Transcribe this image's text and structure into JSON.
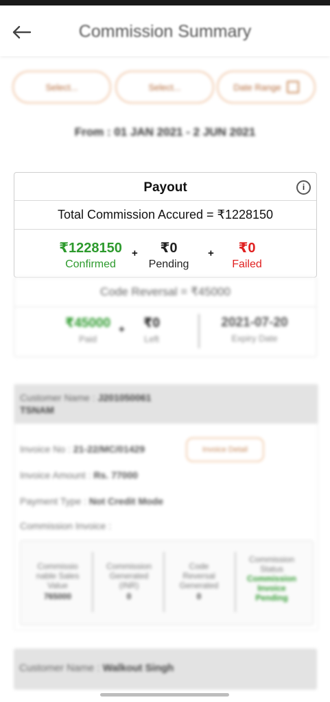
{
  "appbar": {
    "title": "Commission Summary"
  },
  "filters": {
    "pill1": "Select...",
    "pill2": "Select...",
    "date_range_label": "Date Range"
  },
  "date_range_text": "From : 01 JAN 2021 - 2 JUN 2021",
  "payout": {
    "title": "Payout",
    "info_symbol": "i",
    "total_label": "Total Commission Accured = ₹1228150",
    "confirmed": {
      "value": "₹1228150",
      "label": "Confirmed"
    },
    "pending": {
      "value": "₹0",
      "label": "Pending"
    },
    "failed": {
      "value": "₹0",
      "label": "Failed"
    },
    "plus1": "+",
    "plus2": "+"
  },
  "code_reversal": {
    "header": "Code Reversal = ₹45000",
    "paid": {
      "value": "₹45000",
      "label": "Paid"
    },
    "plus": "+",
    "left": {
      "value": "₹0",
      "label": "Left"
    },
    "expiry": {
      "value": "2021-07-20",
      "label": "Expiry Date"
    }
  },
  "invoice_card": {
    "customer_label": "Customer Name :",
    "customer_value_line1": "J201050061",
    "customer_value_line2": "TSNAM",
    "invoice_no_label": "Invoice No :",
    "invoice_no_value": "21-22/MC/01429",
    "invoice_detail_button": "Invoice Detail",
    "invoice_amount_label": "Invoice Amount :",
    "invoice_amount_value": "Rs. 77000",
    "payment_type_label": "Payment Type :",
    "payment_type_value": "Not Credit Mode",
    "commission_invoice_label": "Commission Invoice :",
    "grid": [
      {
        "l1": "Commissio",
        "l2": "nable Sales",
        "l3": "Value",
        "v": "765000"
      },
      {
        "l1": "Commission",
        "l2": "Generated",
        "l3": "(INR)",
        "v": "0"
      },
      {
        "l1": "Code",
        "l2": "Reversal",
        "l3": "Generated",
        "v": "0"
      },
      {
        "l1": "Commission",
        "l2": "Status",
        "g1": "Commission",
        "g2": "Invoice",
        "g3": "Pending"
      }
    ]
  },
  "second_card": {
    "customer_label": "Customer Name :",
    "customer_value": "Walkout Singh"
  },
  "colors": {
    "accent": "#f0c7a8",
    "green": "#2d9a2d",
    "red": "#e02020"
  },
  "icons": {
    "back": "arrow-left-icon",
    "info": "info-icon",
    "calendar": "calendar-icon"
  }
}
